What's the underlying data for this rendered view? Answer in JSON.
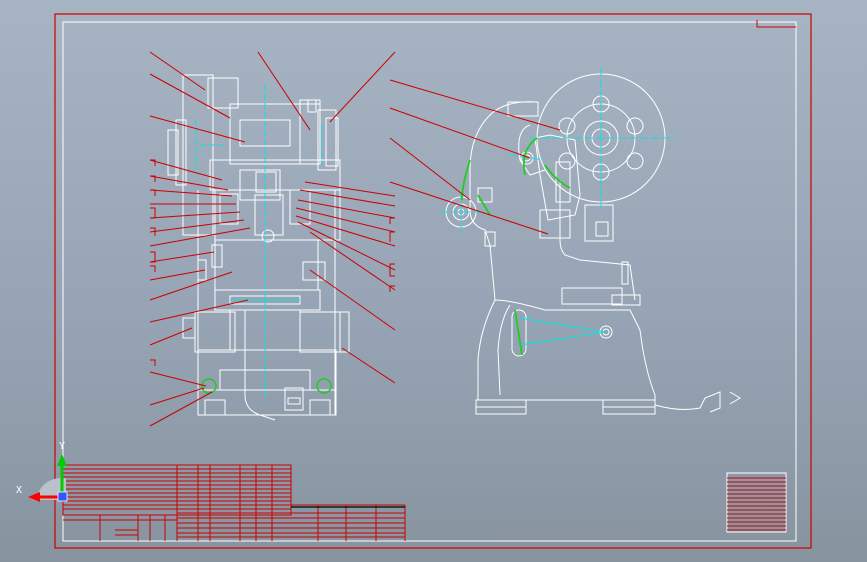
{
  "app": {
    "window_title": ""
  },
  "colors": {
    "background": "#97a4b5",
    "drawing_line": "#ffffff",
    "leader_line": "#cc0000",
    "center_line": "#00e6e6",
    "highlight": "#22cc22",
    "border": "#cc0000"
  },
  "ucs": {
    "x_label": "X",
    "y_label": "Y",
    "x_color": "#ff0000",
    "y_color": "#00cc00"
  },
  "views": [
    {
      "name": "front-view"
    },
    {
      "name": "side-view"
    }
  ]
}
